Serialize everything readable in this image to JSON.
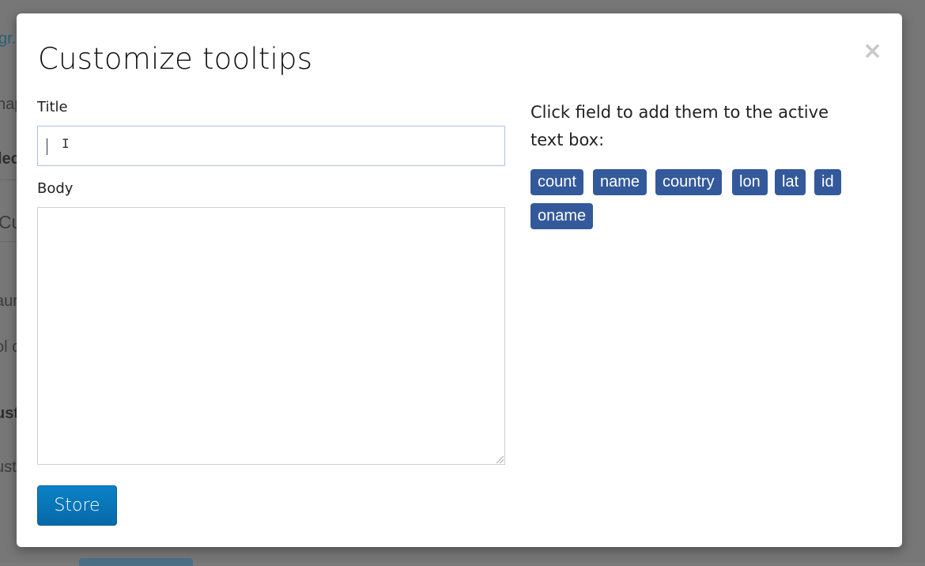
{
  "background": {
    "fragments": [
      "gr.",
      "nap",
      "lec",
      "Cu",
      "aun",
      "ol c",
      "ust",
      "ust"
    ]
  },
  "modal": {
    "title": "Customize tooltips",
    "close_symbol": "×",
    "title_label": "Title",
    "title_value": "",
    "body_label": "Body",
    "body_value": "",
    "store_label": "Store",
    "hint_text": "Click field to add them to the active text box:",
    "fields": [
      "count",
      "name",
      "country",
      "lon",
      "lat",
      "id",
      "oname"
    ]
  },
  "colors": {
    "tag_bg": "#33599b",
    "store_bg": "#0a78be",
    "input_focus_border": "#a9c3e4"
  }
}
